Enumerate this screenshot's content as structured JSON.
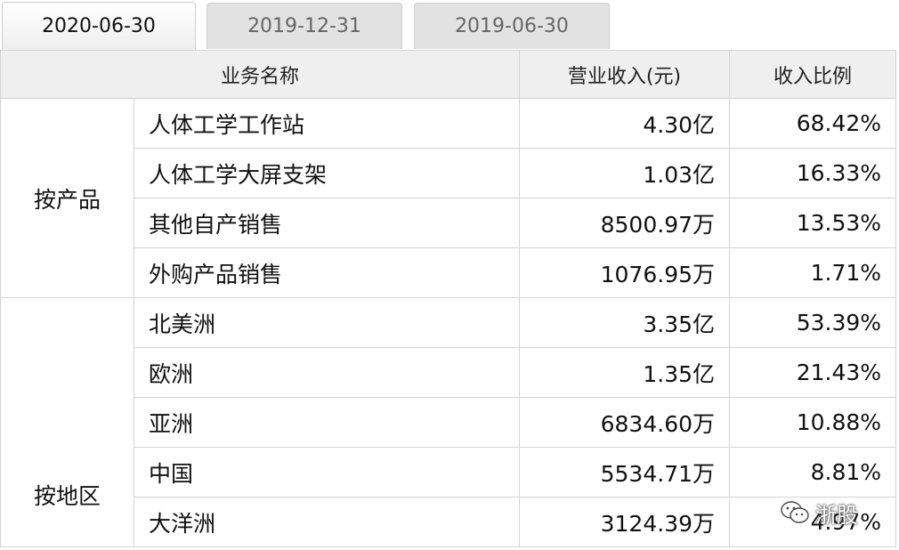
{
  "tabs": [
    {
      "label": "2020-06-30",
      "active": true
    },
    {
      "label": "2019-12-31",
      "active": false
    },
    {
      "label": "2019-06-30",
      "active": false
    }
  ],
  "table": {
    "headers": {
      "name": "业务名称",
      "revenue": "营业收入(元)",
      "ratio": "收入比例"
    },
    "groups": [
      {
        "label": "按产品",
        "rows": [
          {
            "name": "人体工学工作站",
            "revenue": "4.30亿",
            "ratio": "68.42%"
          },
          {
            "name": "人体工学大屏支架",
            "revenue": "1.03亿",
            "ratio": "16.33%"
          },
          {
            "name": "其他自产销售",
            "revenue": "8500.97万",
            "ratio": "13.53%"
          },
          {
            "name": "外购产品销售",
            "revenue": "1076.95万",
            "ratio": "1.71%"
          }
        ]
      },
      {
        "label": "按地区",
        "rows": [
          {
            "name": "北美洲",
            "revenue": "3.35亿",
            "ratio": "53.39%"
          },
          {
            "name": "欧洲",
            "revenue": "1.35亿",
            "ratio": "21.43%"
          },
          {
            "name": "亚洲",
            "revenue": "6834.60万",
            "ratio": "10.88%"
          },
          {
            "name": "中国",
            "revenue": "5534.71万",
            "ratio": "8.81%"
          },
          {
            "name": "大洋洲",
            "revenue": "3124.39万",
            "ratio": "4.97%"
          }
        ]
      }
    ]
  },
  "watermark": {
    "text": "浙股",
    "icon": "wechat-icon"
  }
}
